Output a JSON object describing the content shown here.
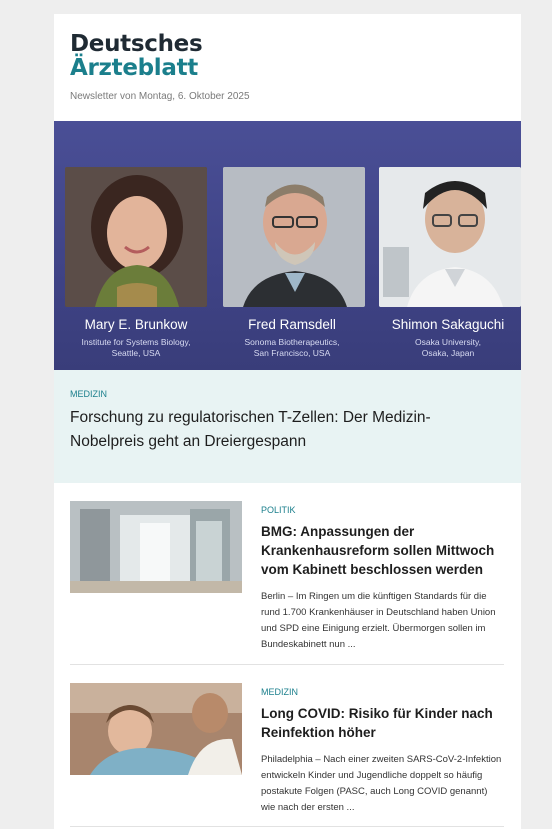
{
  "header": {
    "logo_line1": "Deutsches",
    "logo_line2": "Ärzteblatt",
    "newsletter_date": "Newsletter von Montag, 6. Oktober 2025"
  },
  "hero": {
    "people": [
      {
        "name": "Mary E. Brunkow",
        "affiliation": "Institute for Systems Biology,\nSeattle, USA"
      },
      {
        "name": "Fred Ramsdell",
        "affiliation": "Sonoma Biotherapeutics,\nSan Francisco, USA"
      },
      {
        "name": "Shimon Sakaguchi",
        "affiliation": "Osaka University,\nOsaka, Japan"
      }
    ]
  },
  "lead": {
    "category": "MEDIZIN",
    "title": "Forschung zu regulatorischen T-Zellen: Der Medizin-Nobelpreis geht an Dreiergespann"
  },
  "articles": [
    {
      "category": "POLITIK",
      "title": "BMG: Anpassungen der Krankenhausreform sollen Mittwoch vom Kabinett beschlossen werden",
      "teaser": "Berlin – Im Ringen um die künftigen Standards für die rund 1.700 Krankenhäuser in Deutschland haben Union und SPD eine Einigung erzielt. Übermorgen sollen im Bundeskabinett nun ..."
    },
    {
      "category": "MEDIZIN",
      "title": "Long COVID: Risiko für Kinder nach Reinfektion höher",
      "teaser": "Philadelphia – Nach einer zweiten SARS-CoV-2-Infektion entwickeln Kinder und Jugendliche doppelt so häufig postakute Folgen (PASC, auch Long COVID genannt) wie nach der ersten ..."
    }
  ]
}
